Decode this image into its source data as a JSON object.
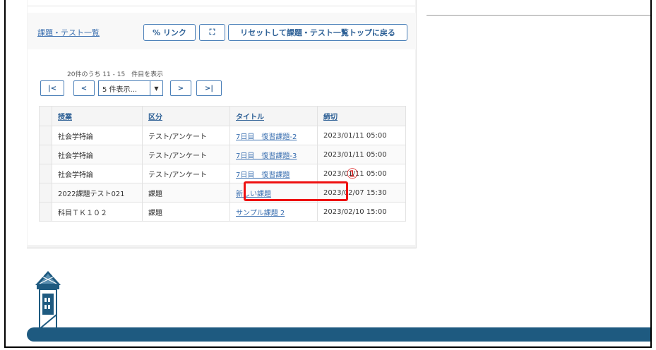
{
  "breadcrumb": "課題・テスト一覧",
  "toolbar": {
    "link_label": "% リンク",
    "expand_icon": "⛶",
    "reset_label": "リセットして課題・テスト一覧トップに戻る"
  },
  "pager": {
    "count_text": "20件のうち 11 - 15　件目を表示",
    "first_label": "|<",
    "prev_label": "<",
    "next_label": ">",
    "last_label": ">|",
    "per_page": "5 件表示..."
  },
  "table": {
    "headers": [
      "授業",
      "区分",
      "タイトル",
      "締切"
    ],
    "rows": [
      {
        "class": "社会学特論",
        "kind": "テスト/アンケート",
        "title": "7日目　復習課題-2",
        "deadline": "2023/01/11 05:00"
      },
      {
        "class": "社会学特論",
        "kind": "テスト/アンケート",
        "title": "7日目　復習課題-3",
        "deadline": "2023/01/11 05:00"
      },
      {
        "class": "社会学特論",
        "kind": "テスト/アンケート",
        "title": "7日目　復習課題",
        "deadline": "2023/01/11 05:00"
      },
      {
        "class": "2022課題テスト021",
        "kind": "課題",
        "title": "新しい課題",
        "deadline": "2023/02/07 15:30"
      },
      {
        "class": "科目ＴＫ１０２",
        "kind": "課題",
        "title": "サンプル課題 2",
        "deadline": "2023/02/10 15:00"
      }
    ]
  },
  "annotation": {
    "marker": "①",
    "color": "#ee1111"
  },
  "colors": {
    "accent": "#2c5f95",
    "footer": "#1e5a80"
  }
}
